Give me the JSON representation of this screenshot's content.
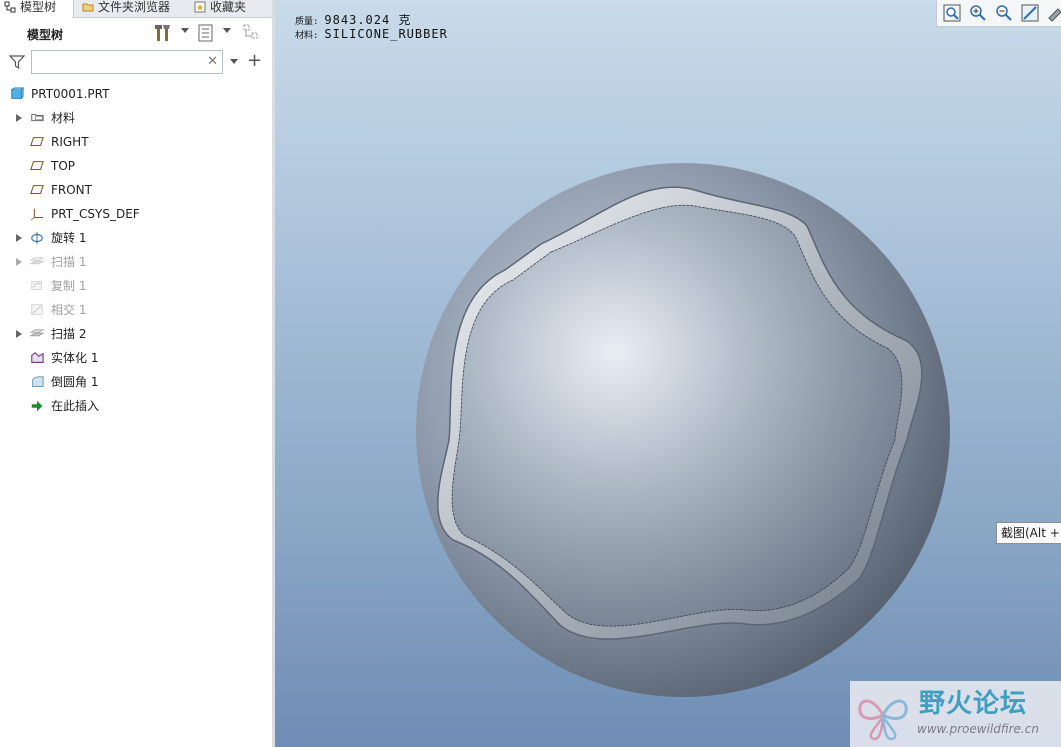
{
  "tabs": [
    {
      "label": "模型树",
      "active": true,
      "icon": "model-tree-icon"
    },
    {
      "label": "文件夹浏览器",
      "active": false,
      "icon": "folder-browser-icon"
    },
    {
      "label": "收藏夹",
      "active": false,
      "icon": "favorites-icon"
    }
  ],
  "toolbar": {
    "title": "模型树",
    "settings_icon": "tree-settings-icon",
    "columns_icon": "show-columns-icon",
    "filter_tree_icon": "tree-filter-icon"
  },
  "search": {
    "placeholder": "",
    "value": ""
  },
  "tree": [
    {
      "label": "PRT0001.PRT",
      "icon": "part-icon",
      "expandable": false,
      "dim": false,
      "root": true
    },
    {
      "label": "材料",
      "icon": "material-icon",
      "expandable": true,
      "dim": false
    },
    {
      "label": "RIGHT",
      "icon": "datum-plane-icon",
      "expandable": false,
      "dim": false
    },
    {
      "label": "TOP",
      "icon": "datum-plane-icon",
      "expandable": false,
      "dim": false
    },
    {
      "label": "FRONT",
      "icon": "datum-plane-icon",
      "expandable": false,
      "dim": false
    },
    {
      "label": "PRT_CSYS_DEF",
      "icon": "coordinate-system-icon",
      "expandable": false,
      "dim": false
    },
    {
      "label": "旋转 1",
      "icon": "revolve-icon",
      "expandable": true,
      "dim": false
    },
    {
      "label": "扫描 1",
      "icon": "sweep-icon",
      "expandable": true,
      "dim": true
    },
    {
      "label": "复制 1",
      "icon": "copy-surface-icon",
      "expandable": false,
      "dim": true
    },
    {
      "label": "相交 1",
      "icon": "intersect-icon",
      "expandable": false,
      "dim": true
    },
    {
      "label": "扫描 2",
      "icon": "sweep-icon",
      "expandable": true,
      "dim": false
    },
    {
      "label": "实体化 1",
      "icon": "solidify-icon",
      "expandable": false,
      "dim": false
    },
    {
      "label": "倒圆角 1",
      "icon": "round-icon",
      "expandable": false,
      "dim": false
    },
    {
      "label": "在此插入",
      "icon": "insert-here-arrow-icon",
      "expandable": false,
      "dim": false
    }
  ],
  "info": {
    "mass_label": "质量:",
    "mass_value": "9843.024 克",
    "material_label": "材料:",
    "material_value": "SILICONE_RUBBER"
  },
  "view_toolbar": [
    "refit-icon",
    "zoom-in-icon",
    "zoom-out-icon",
    "repaint-icon",
    "saved-views-icon"
  ],
  "tooltip": "截图(Alt +",
  "watermark": {
    "title": "野火论坛",
    "url": "www.proewildfire.cn"
  },
  "colors": {
    "viewport_top": "#c9dbea",
    "viewport_bottom": "#6f8db4",
    "accent": "#3f9fc0"
  }
}
